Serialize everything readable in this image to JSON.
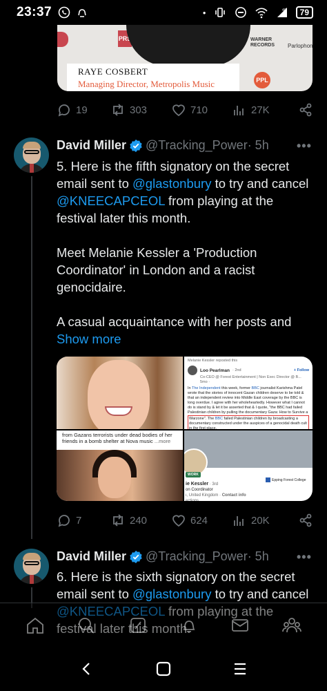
{
  "status_bar": {
    "time": "23:37",
    "battery": "79",
    "network": "4G"
  },
  "top_media": {
    "caption_name": "RAYE COSBERT",
    "caption_role": "Managing Director, Metropolis Music",
    "logo_prs": "PRS",
    "logo_warner": "WARNER RECORDS",
    "logo_parlophone": "Parlophone",
    "logo_ppl": "PPL"
  },
  "tweet0_actions": {
    "replies": "19",
    "reposts": "303",
    "likes": "710",
    "views": "27K"
  },
  "tweet1": {
    "author": "David Miller",
    "handle": "@Tracking_Power",
    "time": " · 5h",
    "p1_a": "5. Here is the fifth signatory on the secret email sent to ",
    "p1_m1": "@glastonbury",
    "p1_b": " to try and cancel ",
    "p1_m2": "@KNEECAPCEOL",
    "p1_c": " from playing at the festival later this month.",
    "p2": "Meet Melanie Kessler a 'Production Coordinator' in London and a racist genocidaire.",
    "p3": "A casual acquaintance with her posts and",
    "show_more": "Show more",
    "actions": {
      "replies": "7",
      "reposts": "240",
      "likes": "624",
      "views": "20K"
    }
  },
  "media": {
    "t2_reposted": "Melanie Kessler reposted this",
    "t2_name": "Loo Pearlman",
    "t2_degree": "· 2nd",
    "t2_follow": "+ Follow",
    "t2_title": "Co-CEO @ Forest Entertainment | Non Exec Director @ B...",
    "t2_time": "5mo ·",
    "t2_text_a": "In ",
    "t2_link1": "The Independent",
    "t2_text_b": " this week, former ",
    "t2_link2": "BBC",
    "t2_text_c": " journalist Karishma Patel wrote that the stories of innocent Gazan children deserve to be told & that an independent review into Middle East coverage by the BBC is long overdue. I agree with her wholeheartedly. However what I cannot do is stand by & let it be asserted that & I quote, \"the BBC had failed Palestinian children by pulling the documentary Gaza: How to Survive a",
    "t2_hl_a": "Warzone\". The ",
    "t2_hl_link": "BBC",
    "t2_hl_b": " failed Palestinian children by broadcasting a documentary constructed under the auspices of a genocidal death cult in the first place.",
    "t3_caption": "from Gazans terrorists under dead bodies of her friends in a bomb shelter at Nova music",
    "t3_more": "...more",
    "t4_name": "ie Kessler",
    "t4_degree": "· 3rd",
    "t4_role": "on Coordinator",
    "t4_loc": "ι, United Kingdom · ",
    "t4_contact": "Contact info",
    "t4_conn": "ections",
    "t4_college": "Epping Forest College",
    "t4_badge": "WORK"
  },
  "tweet2": {
    "author": "David Miller",
    "handle": "@Tracking_Power",
    "time": " · 5h",
    "p1_a": "6. Here is the sixth signatory on the secret email sent to ",
    "p1_m1": "@glastonbury",
    "p1_b": " to try and cancel ",
    "p1_m2": "@KNEECAPCEOL",
    "p1_c": " from playing at the festival later this month."
  },
  "more_menu": "•••",
  "colors": {
    "accent": "#1d9bf0",
    "muted": "#71767b",
    "text": "#e7e9ea",
    "background": "#000000"
  },
  "icons": [
    "whatsapp-icon",
    "notification-icon",
    "vibrate-icon",
    "dnd-icon",
    "wifi-icon",
    "signal-icon",
    "battery-icon",
    "reply-icon",
    "repost-icon",
    "like-icon",
    "views-icon",
    "share-icon",
    "verified-icon",
    "more-icon",
    "home-icon",
    "search-icon",
    "grok-icon",
    "notifications-icon",
    "messages-icon",
    "communities-icon",
    "back-icon",
    "home-button-icon",
    "recents-icon"
  ]
}
